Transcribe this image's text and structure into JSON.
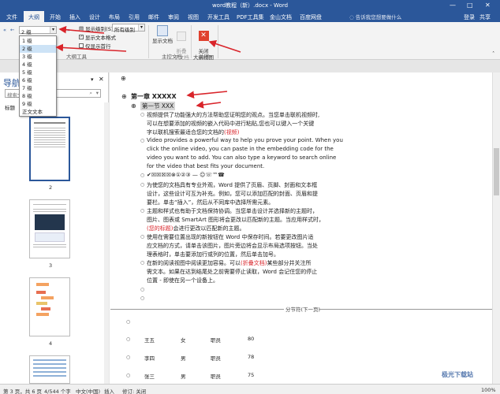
{
  "window": {
    "title": "word教程（新）.docx - Word",
    "controls": [
      "—",
      "□",
      "✕"
    ]
  },
  "tabs": [
    "文件",
    "大纲",
    "开始",
    "插入",
    "设计",
    "布局",
    "引用",
    "邮件",
    "审阅",
    "视图",
    "开发工具",
    "PDF工具集",
    "金山文档",
    "百度网盘"
  ],
  "search_hint": "告诉我您想要做什么",
  "top_right": {
    "login": "登录",
    "share": "共享"
  },
  "ribbon": {
    "level_value": "2 级",
    "show_level_label": "显示级别(S):",
    "show_level_value": "所有级别",
    "show_text_format": "显示文本格式",
    "first_line_only": "仅显示首行",
    "outline_tools_label": "大纲工具",
    "show_document": "显示文档",
    "collapse_subdoc": "折叠\n子文档",
    "master_doc_label": "主控文档",
    "close_outline": "关闭\n大纲视图",
    "close_label": "关闭"
  },
  "level_list": [
    "1 级",
    "2 级",
    "3 级",
    "4 级",
    "5 级",
    "6 级",
    "7 级",
    "8 级",
    "9 级",
    "正文文本"
  ],
  "level_list_selected": 1,
  "nav": {
    "title": "导航",
    "search_placeholder": "搜索文档",
    "tab_label": "标题",
    "pages": [
      "2",
      "3",
      "4"
    ]
  },
  "doc": {
    "chapter": "第一章  XXXXX",
    "section": "第一节  XXX",
    "para1": [
      "视频提供了功能强大的方法帮助您证明您的观点。当您单击联机视频时,",
      "可以在想要添加的视频的嵌入代码中进行粘贴,您也可以键入一个关键",
      "字以联机搜索最适合您的文档的"
    ],
    "para1_red": "(视频)",
    "para2": [
      "Video provides a powerful way to help you prove your point. When you",
      "click the online video, you can paste in the embedding code for the",
      "video you want to add. You can also type a keyword to search online",
      "for the video that best fits your document."
    ],
    "symbols": "✔☒☒☒☒⊗①②③ — ☺☏™☎",
    "para3": [
      "为使您的文档具有专业外观，Word 提供了页眉、页脚、封面和文本框",
      "设计，这些设计可互为补充。例如，您可以添加匹配的封面、页眉和提",
      "要栏。单击“插入”，然后从不同库中选择所需元素。"
    ],
    "para4": [
      "主题和样式也有助于文档保持协调。当您单击设计并选择新的主题时，",
      "图片、图表或 SmartArt 图形将会更改以匹配新的主题。当应用样式时，"
    ],
    "para4_red": "(您的标题)",
    "para4_tail": "会进行更改以匹配新的主题。",
    "para5": [
      "使用在需要位置出现的新按钮在 Word 中保存时间。若要更改图片适",
      "应文档的方式，请单击该图片，图片旁边将会显示布局选项按钮。当处",
      "理表格时，单击要添加行或列的位置，然后单击加号。"
    ],
    "para6_a": "在新的阅读视图中阅读更加容易。可以",
    "para6_red": "(折叠文档)",
    "para6_b": "某些部分并关注所",
    "para6_rest": [
      "需文本。如果在达到结尾处之前需要停止读取，Word 会记住您的停止",
      "位置 - 即使在另一个设备上。"
    ],
    "section_break": "分节符(下一页)",
    "table": [
      [
        "王五",
        "女",
        "职员",
        "80"
      ],
      [
        "李四",
        "男",
        "职员",
        "78"
      ],
      [
        "张三",
        "男",
        "职员",
        "75"
      ]
    ]
  },
  "status": {
    "page": "第 3 页，共 6 页",
    "words": "4/544 个字",
    "lang": "中文(中国)",
    "insert": "插入",
    "recorder": "修订: 关闭",
    "zoom": "100%"
  },
  "watermark": "极光下载站",
  "colors": {
    "accent": "#2b579a",
    "red": "#d9242a",
    "close_btn": "#e0412e"
  }
}
